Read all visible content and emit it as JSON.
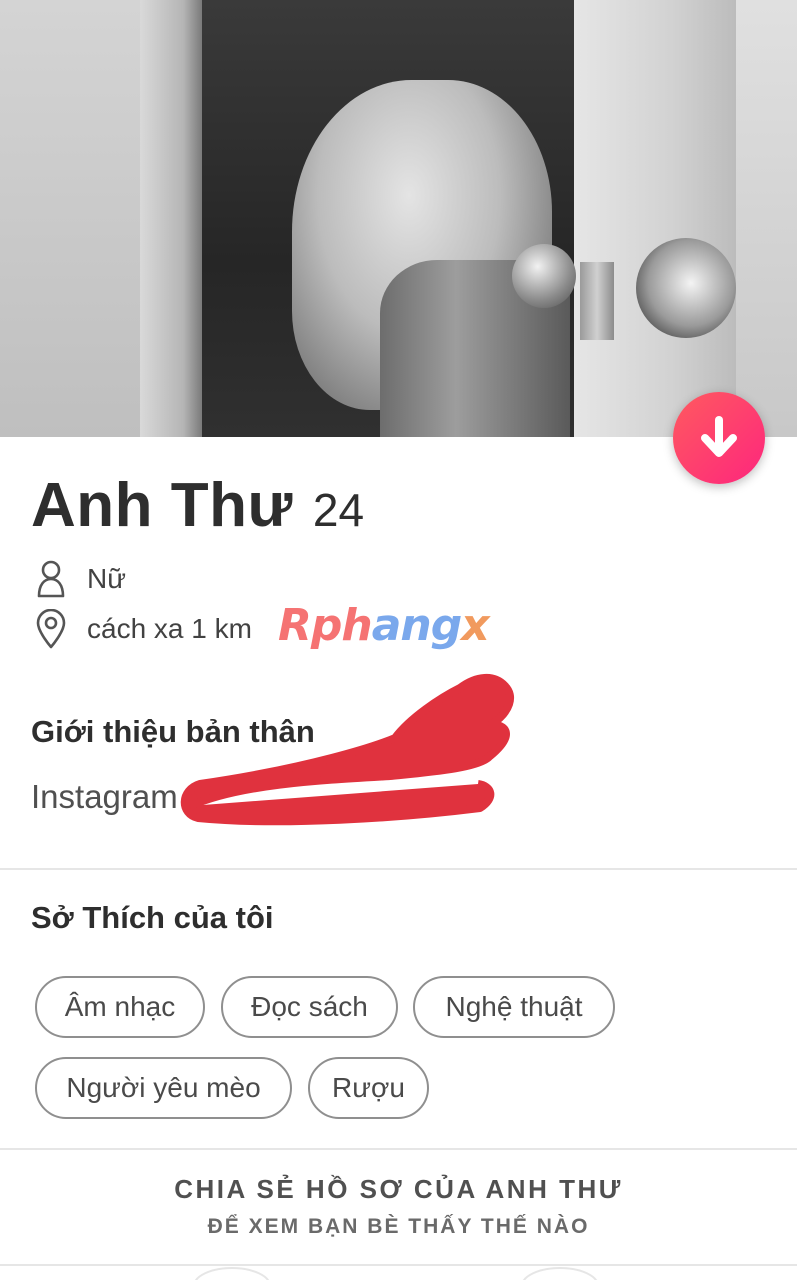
{
  "profile": {
    "name": "Anh Thư",
    "age": "24",
    "gender": "Nữ",
    "distance": "cách xa 1 km"
  },
  "icons": {
    "download": "arrow-down-icon",
    "gender": "person-icon",
    "distance": "location-pin-icon"
  },
  "watermark": {
    "part1": "Rph",
    "part2": "ang",
    "part3": "x"
  },
  "about": {
    "title": "Giới thiệu bản thân",
    "text": "Instagram"
  },
  "interests": {
    "title": "Sở Thích của tôi",
    "items": [
      "Âm nhạc",
      "Đọc sách",
      "Nghệ thuật",
      "Người yêu mèo",
      "Rượu"
    ]
  },
  "share": {
    "title": "CHIA SẺ HỒ SƠ CỦA ANH THƯ",
    "subtitle": "ĐỂ XEM BẠN BÈ THẤY THẾ NÀO"
  },
  "colors": {
    "accent_start": "#ff5a5f",
    "accent_end": "#fd267d",
    "redaction": "#e0323e"
  }
}
